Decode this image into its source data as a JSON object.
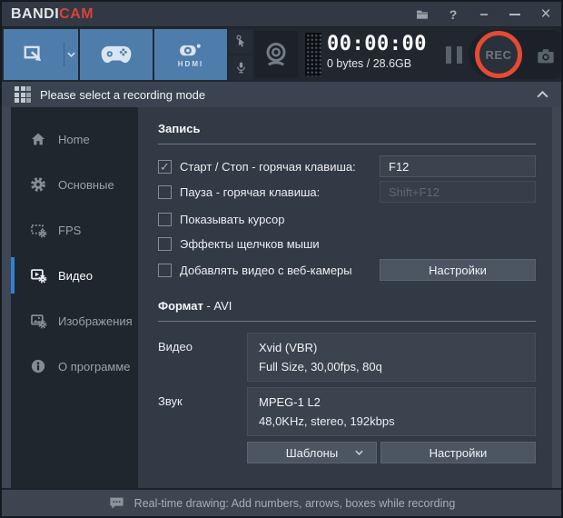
{
  "titlebar": {
    "brand_white": "BANDI",
    "brand_red": "CAM",
    "help_label": "?"
  },
  "toolbar": {
    "hdmi_label": "HDMI",
    "timer": "00:00:00",
    "size_info": "0 bytes / 28.6GB",
    "rec_label": "REC"
  },
  "modebar": {
    "text": "Please select a recording mode"
  },
  "sidebar": {
    "items": [
      {
        "label": "Home"
      },
      {
        "label": "Основные"
      },
      {
        "label": "FPS"
      },
      {
        "label": "Видео",
        "selected": true
      },
      {
        "label": "Изображения"
      },
      {
        "label": "О программе"
      }
    ]
  },
  "record_section": {
    "title": "Запись",
    "check_glyph": "✓",
    "rows": [
      {
        "label": "Старт / Стоп - горячая клавиша:",
        "checked": true,
        "value": "F12"
      },
      {
        "label": "Пауза - горячая клавиша:",
        "checked": false,
        "value": "Shift+F12",
        "disabled": true
      },
      {
        "label": "Показывать курсор",
        "checked": false
      },
      {
        "label": "Эффекты щелчков мыши",
        "checked": false
      },
      {
        "label": "Добавлять видео с веб-камеры",
        "checked": false,
        "button": "Настройки"
      }
    ]
  },
  "format_section": {
    "title": "Формат",
    "suffix": " - AVI",
    "video_label": "Видео",
    "video_codec": "Xvid (VBR)",
    "video_details": "Full Size, 30,00fps, 80q",
    "audio_label": "Звук",
    "audio_codec": "MPEG-1 L2",
    "audio_details": "48,0KHz, stereo, 192kbps",
    "templates_button": "Шаблоны",
    "settings_button": "Настройки"
  },
  "footer": {
    "text": "Real-time drawing: Add numbers, arrows, boxes while recording"
  },
  "colors": {
    "accent_blue": "#4e7dab",
    "rec_red": "#e64a33",
    "logo_red": "#d8413c",
    "selected_blue": "#2f81d6"
  }
}
